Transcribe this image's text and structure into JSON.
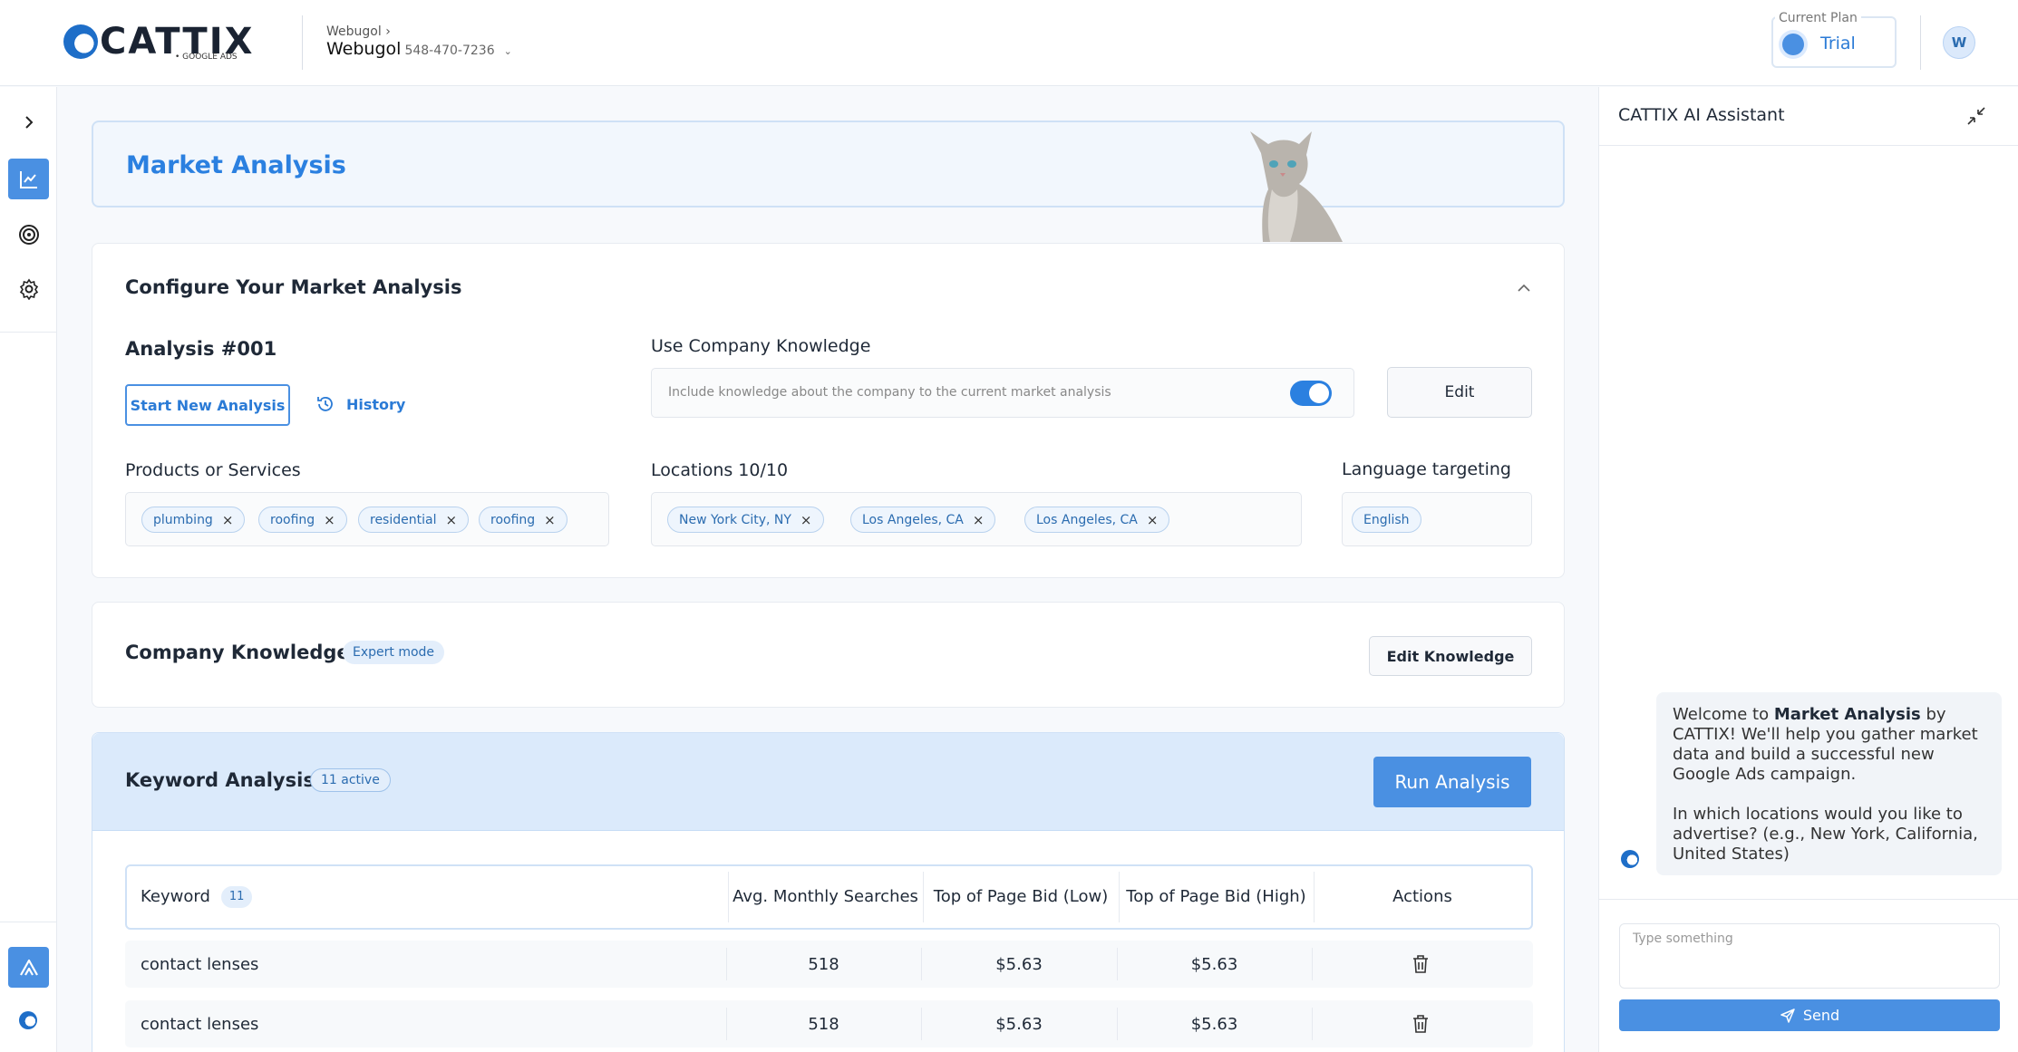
{
  "brand": {
    "name": "CATTIX",
    "sub": "• GOOGLE ADS"
  },
  "account": {
    "breadcrumb": "Webugol ›",
    "name": "Webugol",
    "id": "548-470-7236"
  },
  "plan": {
    "label": "Current Plan",
    "value": "Trial"
  },
  "user": {
    "initial": "W"
  },
  "sidebar": {
    "items": [
      "expand-icon",
      "analytics-icon",
      "target-icon",
      "settings-icon"
    ],
    "bottom": [
      "app-logo-icon",
      "cattix-icon"
    ]
  },
  "hero": {
    "title": "Market Analysis"
  },
  "config": {
    "title": "Configure Your Market Analysis",
    "analysis_id": "Analysis #001",
    "start_new": "Start New Analysis",
    "history": "History",
    "use_company_knowledge": "Use Company Knowledge",
    "knowledge_hint": "Include knowledge about the company to the current market analysis",
    "knowledge_enabled": true,
    "edit": "Edit",
    "products_label": "Products or Services",
    "products": [
      "plumbing",
      "roofing",
      "residential",
      "roofing"
    ],
    "locations_label": "Locations 10/10",
    "locations": [
      "New York City, NY",
      "Los Angeles, CA",
      "Los Angeles, CA"
    ],
    "language_label": "Language targeting",
    "languages": [
      "English"
    ]
  },
  "company_knowledge": {
    "title": "Company Knowledge",
    "badge": "Expert mode",
    "button": "Edit Knowledge"
  },
  "keyword_analysis": {
    "title": "Keyword Analysis",
    "badge": "11  active",
    "run": "Run Analysis",
    "columns": {
      "keyword": "Keyword",
      "count": "11",
      "searches": "Avg. Monthly Searches",
      "low": "Top of Page Bid (Low)",
      "high": "Top of Page Bid (High)",
      "actions": "Actions"
    },
    "rows": [
      {
        "keyword": "contact lenses",
        "searches": "518",
        "low": "$5.63",
        "high": "$5.63"
      },
      {
        "keyword": "contact lenses",
        "searches": "518",
        "low": "$5.63",
        "high": "$5.63"
      }
    ]
  },
  "assistant": {
    "title": "CATTIX AI Assistant",
    "msg_p1_a": "Welcome to ",
    "msg_p1_b": "Market Analysis",
    "msg_p1_c": " by CATTIX! We'll help you gather market data and build a successful new Google Ads campaign.",
    "msg_p2": "In which locations would you like to advertise? (e.g., New York, California, United States)",
    "input_placeholder": "Type something",
    "send": "Send"
  },
  "colors": {
    "accent": "#4a90e2",
    "title_blue": "#2b80e0",
    "header_bg": "#dbeafb"
  }
}
